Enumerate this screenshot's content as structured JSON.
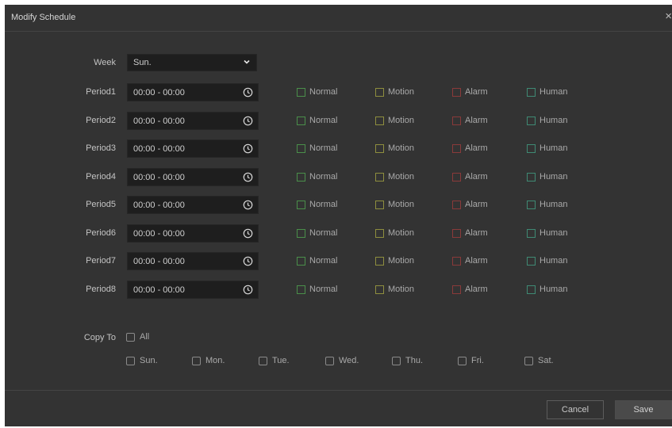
{
  "dialog": {
    "title": "Modify Schedule",
    "close_glyph": "×"
  },
  "week": {
    "label": "Week",
    "value": "Sun."
  },
  "periods": [
    {
      "label": "Period1",
      "time": "00:00 - 00:00"
    },
    {
      "label": "Period2",
      "time": "00:00 - 00:00"
    },
    {
      "label": "Period3",
      "time": "00:00 - 00:00"
    },
    {
      "label": "Period4",
      "time": "00:00 - 00:00"
    },
    {
      "label": "Period5",
      "time": "00:00 - 00:00"
    },
    {
      "label": "Period6",
      "time": "00:00 - 00:00"
    },
    {
      "label": "Period7",
      "time": "00:00 - 00:00"
    },
    {
      "label": "Period8",
      "time": "00:00 - 00:00"
    }
  ],
  "record_types": {
    "normal": "Normal",
    "motion": "Motion",
    "alarm": "Alarm",
    "human": "Human"
  },
  "record_type_colors": {
    "normal": "#4a8f4a",
    "motion": "#8e8e3e",
    "alarm": "#8a3a3a",
    "human": "#3f8a74"
  },
  "copy_to": {
    "label": "Copy To",
    "all": "All",
    "days": [
      "Sun.",
      "Mon.",
      "Tue.",
      "Wed.",
      "Thu.",
      "Fri.",
      "Sat."
    ]
  },
  "footer": {
    "cancel_label": "Cancel",
    "save_label": "Save"
  }
}
